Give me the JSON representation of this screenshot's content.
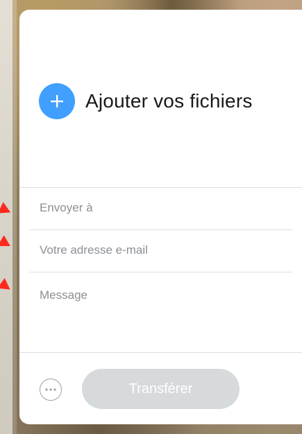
{
  "upload": {
    "add_files_label": "Ajouter vos fichiers",
    "icon": "plus-icon",
    "accent_color": "#409fff"
  },
  "form": {
    "recipient_placeholder": "Envoyer à",
    "recipient_value": "",
    "sender_email_placeholder": "Votre adresse e-mail",
    "sender_email_value": "",
    "message_placeholder": "Message",
    "message_value": ""
  },
  "footer": {
    "more_icon": "more-options-icon",
    "transfer_label": "Transférer",
    "transfer_button_color": "#d6dadc"
  },
  "annotations": {
    "arrow_color": "#ff2a1c"
  }
}
